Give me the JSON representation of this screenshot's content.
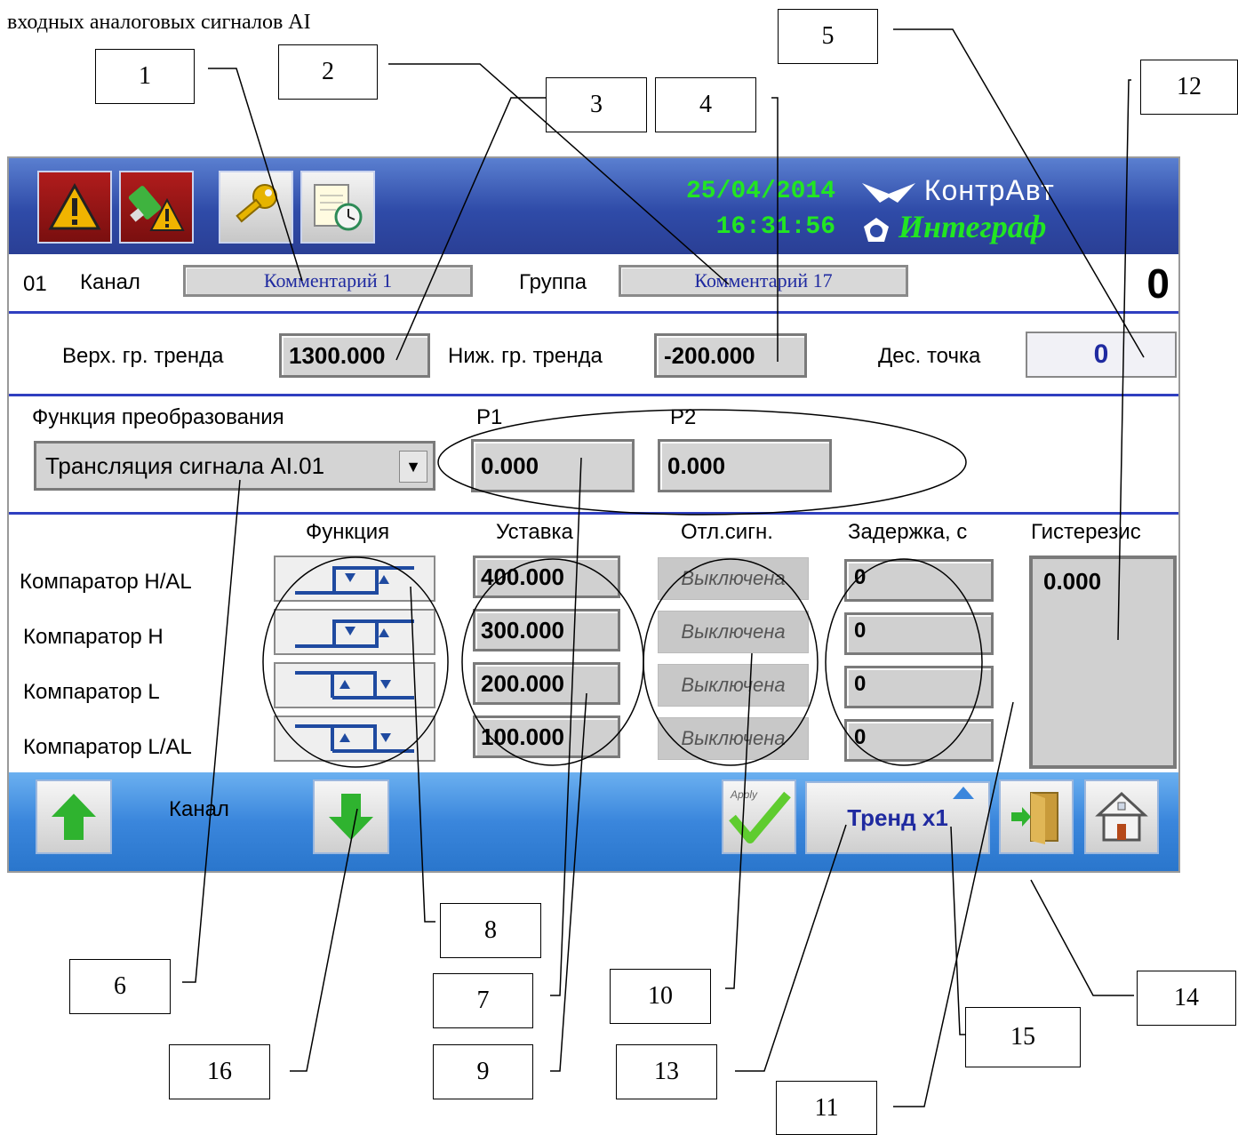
{
  "doc": {
    "intro_line": "входных аналоговых сигналов AI"
  },
  "callouts": [
    "1",
    "2",
    "3",
    "4",
    "5",
    "6",
    "7",
    "8",
    "9",
    "10",
    "11",
    "12",
    "13",
    "14",
    "15",
    "16"
  ],
  "header": {
    "date": "25/04/2014",
    "time": "16:31:56",
    "brand": "КонтрАвт",
    "product": "Интеграф",
    "buttons": [
      "alarm-icon",
      "usb-alarm-icon",
      "key-icon",
      "schedule-icon"
    ]
  },
  "channel_row": {
    "number": "01",
    "channel_label": "Канал",
    "channel_comment": "Комментарий 1",
    "group_label": "Группа",
    "group_comment": "Комментарий 17",
    "value": "0"
  },
  "trend_row": {
    "upper_label": "Верх. гр. тренда",
    "upper_value": "1300.000",
    "lower_label": "Ниж. гр. тренда",
    "lower_value": "-200.000",
    "decimal_label": "Дес. точка",
    "decimal_value": "0"
  },
  "transform": {
    "label": "Функция преобразования",
    "selected": "Трансляция сигнала  AI.01",
    "p1_label": "P1",
    "p1_value": "0.000",
    "p2_label": "P2",
    "p2_value": "0.000"
  },
  "comparators": {
    "headers": {
      "function": "Функция",
      "setpoint": "Уставка",
      "disable": "Отл.сигн.",
      "delay": "Задержка, с",
      "hysteresis": "Гистерезис"
    },
    "hysteresis_value": "0.000",
    "rows": [
      {
        "label": "Компаратор H/AL",
        "setpoint": "400.000",
        "disable": "Выключена",
        "delay": "0"
      },
      {
        "label": "Компаратор H",
        "setpoint": "300.000",
        "disable": "Выключена",
        "delay": "0"
      },
      {
        "label": "Компаратор L",
        "setpoint": "200.000",
        "disable": "Выключена",
        "delay": "0"
      },
      {
        "label": "Компаратор L/AL",
        "setpoint": "100.000",
        "disable": "Выключена",
        "delay": "0"
      }
    ]
  },
  "footer": {
    "channel_label": "Канал",
    "trend_label": "Тренд x1",
    "apply_label": "Apply"
  }
}
